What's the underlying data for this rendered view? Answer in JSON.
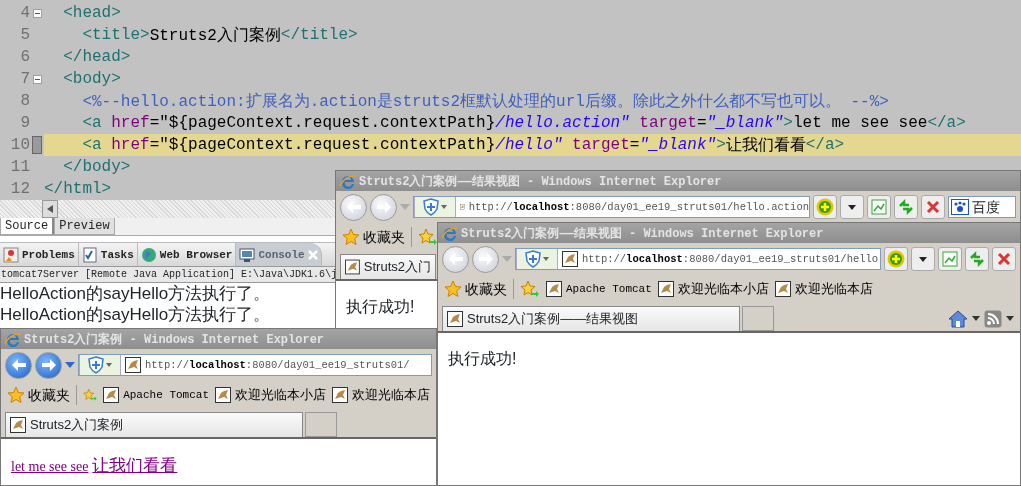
{
  "editor": {
    "lines": [
      {
        "number": "4",
        "fold": true,
        "highlighted": false,
        "segments": [
          {
            "kind": "tag",
            "text": "  <head>"
          }
        ]
      },
      {
        "number": "5",
        "fold": false,
        "highlighted": false,
        "segments": [
          {
            "kind": "tag",
            "text": "    <title>"
          },
          {
            "kind": "text",
            "text": "Struts2入门案例"
          },
          {
            "kind": "tag",
            "text": "</title>"
          }
        ]
      },
      {
        "number": "6",
        "fold": false,
        "highlighted": false,
        "segments": [
          {
            "kind": "tag",
            "text": "  </head>"
          }
        ]
      },
      {
        "number": "7",
        "fold": true,
        "highlighted": false,
        "segments": [
          {
            "kind": "tag",
            "text": "  <body>"
          }
        ]
      },
      {
        "number": "8",
        "fold": false,
        "highlighted": false,
        "segments": [
          {
            "kind": "comment",
            "text": "    <%--hello.action:扩展名为.action是struts2框默认处理的url后缀。除此之外什么都不写也可以。 --%>"
          }
        ]
      },
      {
        "number": "9",
        "fold": false,
        "highlighted": false,
        "segments": [
          {
            "kind": "tag",
            "text": "    <a"
          },
          {
            "kind": "attr",
            "text": " href"
          },
          {
            "kind": "text",
            "text": "="
          },
          {
            "kind": "el",
            "text": "\"${pageContext.request.contextPath}"
          },
          {
            "kind": "value",
            "text": "/hello.action\""
          },
          {
            "kind": "attr",
            "text": " target"
          },
          {
            "kind": "text",
            "text": "="
          },
          {
            "kind": "value",
            "text": "\"_blank\""
          },
          {
            "kind": "tag",
            "text": ">"
          },
          {
            "kind": "text",
            "text": "let me see see"
          },
          {
            "kind": "tag",
            "text": "</a>"
          }
        ]
      },
      {
        "number": "10",
        "fold": false,
        "highlighted": true,
        "segments": [
          {
            "kind": "tag",
            "text": "    <a"
          },
          {
            "kind": "attr",
            "text": " href"
          },
          {
            "kind": "text",
            "text": "="
          },
          {
            "kind": "el",
            "text": "\"${pageContext.request.contextPath}"
          },
          {
            "kind": "value",
            "text": "/hello\""
          },
          {
            "kind": "attr",
            "text": " target"
          },
          {
            "kind": "text",
            "text": "="
          },
          {
            "kind": "value",
            "text": "\"_blank\""
          },
          {
            "kind": "tag",
            "text": ">"
          },
          {
            "kind": "text",
            "text": "让我们看看"
          },
          {
            "kind": "tag",
            "text": "</a>"
          }
        ]
      },
      {
        "number": "11",
        "fold": false,
        "highlighted": false,
        "segments": [
          {
            "kind": "tag",
            "text": "  </body>"
          }
        ]
      },
      {
        "number": "12",
        "fold": false,
        "highlighted": false,
        "segments": [
          {
            "kind": "tag",
            "text": "</html>"
          }
        ]
      }
    ],
    "tabs": [
      {
        "label": "Source",
        "selected": true
      },
      {
        "label": "Preview",
        "selected": false
      }
    ]
  },
  "views": {
    "tabs": [
      {
        "label": "Problems",
        "kind": "problems",
        "selected": false
      },
      {
        "label": "Tasks",
        "kind": "tasks",
        "selected": false
      },
      {
        "label": "Web Browser",
        "kind": "browser",
        "selected": false
      },
      {
        "label": "Console",
        "kind": "console",
        "selected": true
      }
    ],
    "console": {
      "header": "tomcat7Server [Remote Java Application] E:\\Java\\JDK1.6\\j",
      "lines": [
        "HelloAction的sayHello方法执行了。",
        "HelloAction的sayHello方法执行了。"
      ]
    }
  },
  "browser_windows": [
    {
      "title": "Struts2入门案例——结果视图 - Windows Internet Explorer",
      "history_enabled": false,
      "address": "http://**localhost**:8080/day01_ee19_struts01/hello.action",
      "address_tools": true,
      "search": {
        "value": "百度"
      },
      "favorites_label": "收藏夹",
      "tab": {
        "label": "Struts2入门",
        "selected": true
      },
      "tab_tools": false,
      "content": [
        {
          "kind": "text",
          "text": "执行成功!"
        }
      ]
    },
    {
      "title": "Struts2入门案例——结果视图 - Windows Internet Explorer",
      "history_enabled": false,
      "address": "http://**localhost**:8080/day01_ee19_struts01/hello",
      "address_tools": true,
      "favorites_label": "收藏夹",
      "favorites": [
        "Apache Tomcat",
        "欢迎光临本小店",
        "欢迎光临本店"
      ],
      "tab": {
        "label": "Struts2入门案例——结果视图",
        "selected": true
      },
      "tab_tools": true,
      "content": [
        {
          "kind": "text",
          "text": "执行成功!"
        }
      ]
    },
    {
      "title": "Struts2入门案例 - Windows Internet Explorer",
      "history_enabled": true,
      "address": "http://**localhost**:8080/day01_ee19_struts01/",
      "address_tools": false,
      "favorites_label": "收藏夹",
      "favorites": [
        "Apache Tomcat",
        "欢迎光临本小店",
        "欢迎光临本店"
      ],
      "tab": {
        "label": "Struts2入门案例",
        "selected": true
      },
      "tab_tools": false,
      "content": [
        {
          "kind": "link",
          "text": "let me see see",
          "visited": true
        },
        {
          "kind": "link",
          "text": "让我们看看",
          "visited": true
        }
      ]
    }
  ]
}
